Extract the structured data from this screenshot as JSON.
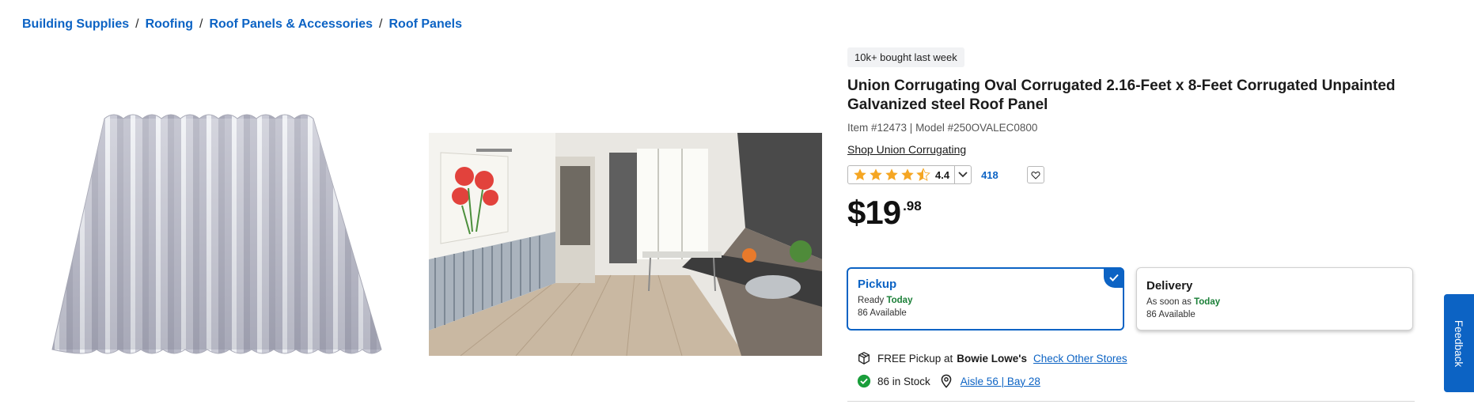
{
  "breadcrumb": {
    "items": [
      "Building Supplies",
      "Roofing",
      "Roof Panels & Accessories",
      "Roof Panels"
    ],
    "separator": "/"
  },
  "product": {
    "badge": "10k+ bought last week",
    "title": "Union Corrugating Oval Corrugated 2.16-Feet x 8-Feet Corrugated Unpainted Galvanized steel Roof Panel",
    "meta": "Item #12473 | Model #250OVALEC0800",
    "shop_link": "Shop Union Corrugating",
    "rating": "4.4",
    "rating_fraction": 0.88,
    "review_count": "418",
    "price_dollars": "$19",
    "price_cents": ".98"
  },
  "fulfillment": {
    "pickup": {
      "title": "Pickup",
      "line1_prefix": "Ready",
      "line1_today": "Today",
      "line2": "86 Available",
      "selected": true
    },
    "delivery": {
      "title": "Delivery",
      "line1_prefix": "As soon as",
      "line1_today": "Today",
      "line2": "86 Available",
      "selected": false
    }
  },
  "store": {
    "free_pickup_text": "FREE Pickup at",
    "store_name": "Bowie Lowe's",
    "check_stores_link": "Check Other Stores",
    "stock_text": "86 in Stock",
    "aisle_link": "Aisle 56 | Bay 28"
  },
  "feedback_label": "Feedback",
  "colors": {
    "accent": "#0c63c4",
    "today_green": "#1a7f37",
    "star": "#f5a623",
    "stock_green": "#1a9e3b"
  },
  "icons": [
    "chevron-down-icon",
    "heart-icon",
    "box-icon",
    "check-circle-icon",
    "location-pin-icon",
    "checkmark-icon",
    "star-icon"
  ]
}
